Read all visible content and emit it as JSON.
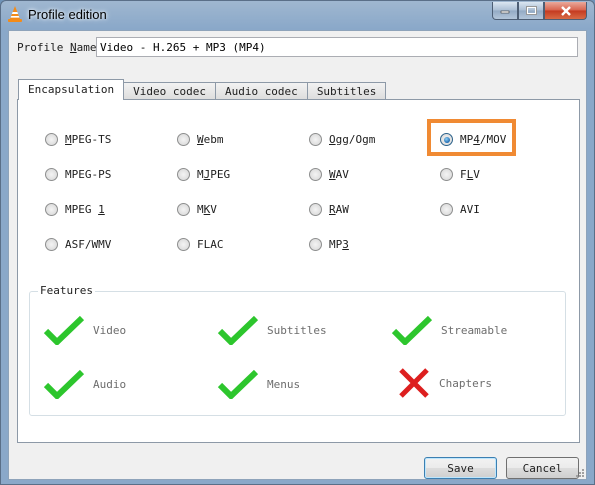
{
  "window": {
    "title": "Profile edition",
    "colors": {
      "accent": "#f08a33",
      "check": "#2dc62d",
      "cross": "#dd1f1f"
    }
  },
  "profile": {
    "label_before": "Profile ",
    "label_underlined": "N",
    "label_after": "ame",
    "value": "Video - H.265 + MP3 (MP4)"
  },
  "tabs": [
    "Encapsulation",
    "Video codec",
    "Audio codec",
    "Subtitles"
  ],
  "encapsulation": {
    "options": [
      {
        "pre": "",
        "u": "M",
        "post": "PEG-TS"
      },
      {
        "pre": "",
        "u": "W",
        "post": "ebm"
      },
      {
        "pre": "",
        "u": "O",
        "post": "gg/Ogm"
      },
      {
        "pre": "MP",
        "u": "4",
        "post": "/MOV"
      },
      {
        "pre": "",
        "u": "",
        "post": "MPEG-PS"
      },
      {
        "pre": "M",
        "u": "J",
        "post": "PEG"
      },
      {
        "pre": "",
        "u": "W",
        "post": "AV"
      },
      {
        "pre": "F",
        "u": "L",
        "post": "V"
      },
      {
        "pre": "MPEG ",
        "u": "1",
        "post": ""
      },
      {
        "pre": "M",
        "u": "K",
        "post": "V"
      },
      {
        "pre": "",
        "u": "R",
        "post": "AW"
      },
      {
        "pre": "",
        "u": "",
        "post": "AVI"
      },
      {
        "pre": "",
        "u": "",
        "post": "ASF/WMV"
      },
      {
        "pre": "",
        "u": "",
        "post": "FLAC"
      },
      {
        "pre": "MP",
        "u": "3",
        "post": ""
      }
    ],
    "selected": "MP4/MOV"
  },
  "features": {
    "title": "Features",
    "items": [
      {
        "label": "Video",
        "supported": true,
        "icon": "check-icon"
      },
      {
        "label": "Subtitles",
        "supported": true,
        "icon": "check-icon"
      },
      {
        "label": "Streamable",
        "supported": true,
        "icon": "check-icon"
      },
      {
        "label": "Audio",
        "supported": true,
        "icon": "check-icon"
      },
      {
        "label": "Menus",
        "supported": true,
        "icon": "check-icon"
      },
      {
        "label": "Chapters",
        "supported": false,
        "icon": "cross-icon"
      }
    ]
  },
  "buttons": {
    "save": "Save",
    "cancel": "Cancel"
  }
}
